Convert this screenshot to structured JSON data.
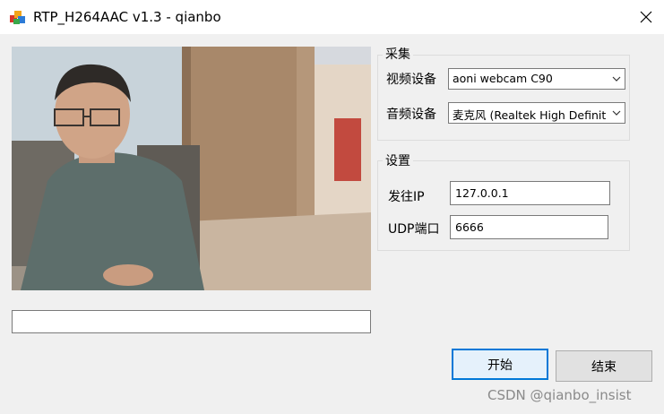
{
  "window": {
    "title": "RTP_H264AAC v1.3 - qianbo",
    "app_icon": "colored-blocks-icon",
    "close_icon": "close-icon"
  },
  "capture_group": {
    "label": "采集",
    "video_device_label": "视频设备",
    "video_device_value": "aoni webcam C90",
    "audio_device_label": "音频设备",
    "audio_device_value": "麦克风 (Realtek High Definitio"
  },
  "settings_group": {
    "label": "设置",
    "ip_label": "发往IP",
    "ip_value": "127.0.0.1",
    "port_label": "UDP端口",
    "port_value": "6666"
  },
  "buttons": {
    "start": "开始",
    "stop": "结束"
  },
  "status_text": "",
  "watermark": "CSDN @qianbo_insist"
}
